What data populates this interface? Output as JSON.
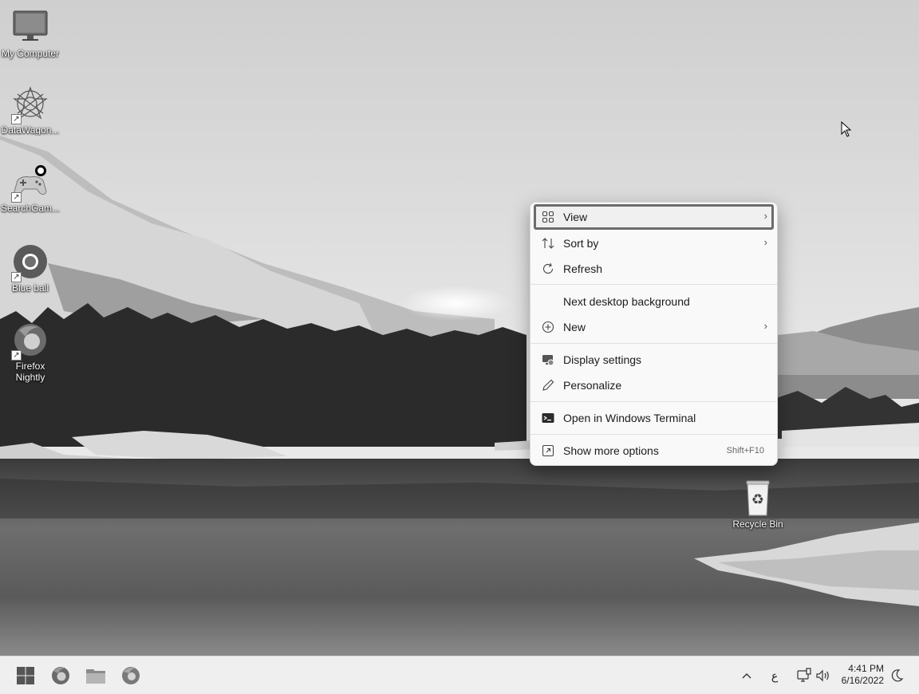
{
  "desktop": {
    "icons": [
      {
        "label": "My Computer"
      },
      {
        "label": "DataWagon..."
      },
      {
        "label": "SearchGam..."
      },
      {
        "label": "Blue ball"
      },
      {
        "label": "Firefox Nightly"
      }
    ],
    "recycle_bin": {
      "label": "Recycle Bin"
    }
  },
  "context_menu": {
    "items": [
      {
        "label": "View",
        "icon": "grid-icon",
        "submenu": true
      },
      {
        "label": "Sort by",
        "icon": "sort-icon",
        "submenu": true
      },
      {
        "label": "Refresh",
        "icon": "refresh-icon"
      },
      {
        "label": "Next desktop background"
      },
      {
        "label": "New",
        "icon": "plus-circle-icon",
        "submenu": true
      },
      {
        "label": "Display settings",
        "icon": "display-settings-icon"
      },
      {
        "label": "Personalize",
        "icon": "pen-icon"
      },
      {
        "label": "Open in Windows Terminal",
        "icon": "terminal-icon"
      },
      {
        "label": "Show more options",
        "icon": "more-options-icon",
        "shortcut": "Shift+F10"
      }
    ]
  },
  "taskbar": {
    "apps": [
      "start-icon",
      "firefox-icon",
      "file-explorer-icon",
      "firefox-nightly-icon"
    ],
    "tray": {
      "chevron": "^",
      "input_indicator": "ع"
    },
    "clock": {
      "time": "4:41 PM",
      "date": "6/16/2022"
    }
  },
  "colors": {
    "menu_bg": "#f9f9f9",
    "selected_border": "#6b6b6b",
    "taskbar_bg": "#efefef"
  }
}
